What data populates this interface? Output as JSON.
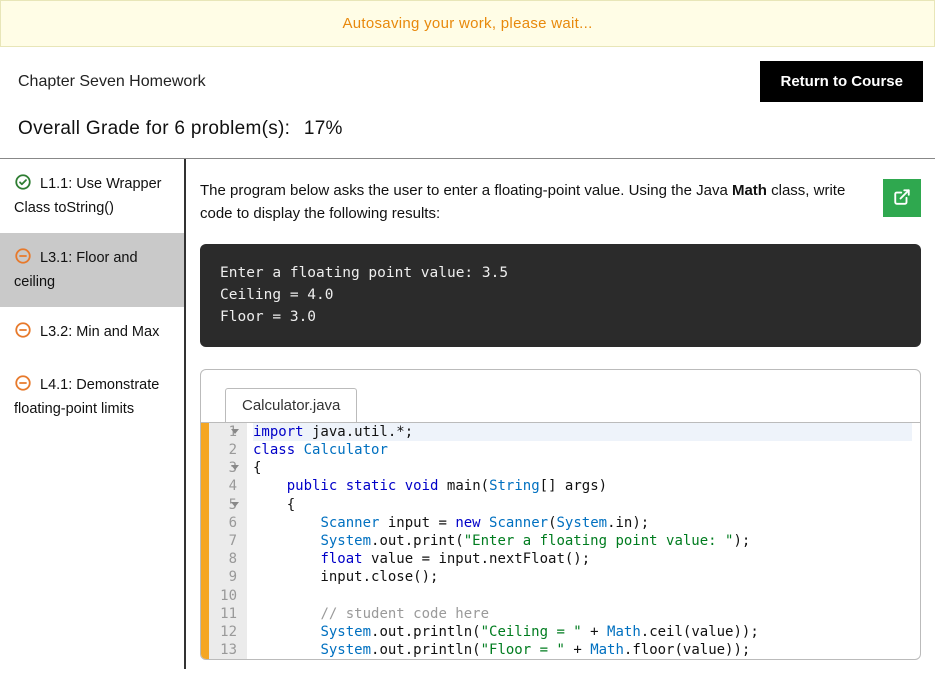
{
  "banner": {
    "text": "Autosaving your work, please wait..."
  },
  "header": {
    "chapter_title": "Chapter Seven Homework",
    "return_label": "Return to Course"
  },
  "grade": {
    "prefix": "Overall Grade for 6 problem(s):",
    "percent": "17%"
  },
  "sidebar": {
    "items": [
      {
        "id": "l1-1",
        "label": "L1.1: Use Wrapper Class toString()",
        "status": "complete",
        "selected": false
      },
      {
        "id": "l3-1",
        "label": "L3.1: Floor and ceiling",
        "status": "pending",
        "selected": true
      },
      {
        "id": "l3-2",
        "label": "L3.2: Min and Max",
        "status": "pending",
        "selected": false
      },
      {
        "id": "l4-1",
        "label": "L4.1: Demonstrate floating-point limits",
        "status": "pending",
        "selected": false
      }
    ]
  },
  "problem": {
    "instructions_pre": "The program below asks the user to enter a floating-point value. Using the Java ",
    "instructions_bold": "Math",
    "instructions_post": " class, write code to display the following results:",
    "console_output": "Enter a floating point value: 3.5\nCeiling = 4.0\nFloor = 3.0",
    "editor": {
      "filename": "Calculator.java",
      "lines": [
        {
          "n": 1,
          "fold": true,
          "tokens": [
            [
              "kw",
              "import"
            ],
            [
              "",
              " java.util.*;"
            ]
          ]
        },
        {
          "n": 2,
          "fold": false,
          "tokens": [
            [
              "kw",
              "class"
            ],
            [
              "",
              " "
            ],
            [
              "cls",
              "Calculator"
            ]
          ]
        },
        {
          "n": 3,
          "fold": true,
          "tokens": [
            [
              "",
              "{"
            ]
          ]
        },
        {
          "n": 4,
          "fold": false,
          "tokens": [
            [
              "",
              "    "
            ],
            [
              "kw",
              "public"
            ],
            [
              "",
              " "
            ],
            [
              "kw",
              "static"
            ],
            [
              "",
              " "
            ],
            [
              "kw",
              "void"
            ],
            [
              "",
              " "
            ],
            [
              "fn",
              "main"
            ],
            [
              "",
              "("
            ],
            [
              "cls",
              "String"
            ],
            [
              "",
              "[] args)"
            ]
          ]
        },
        {
          "n": 5,
          "fold": true,
          "tokens": [
            [
              "",
              "    {"
            ]
          ]
        },
        {
          "n": 6,
          "fold": false,
          "tokens": [
            [
              "",
              "        "
            ],
            [
              "cls",
              "Scanner"
            ],
            [
              "",
              " input = "
            ],
            [
              "kw",
              "new"
            ],
            [
              "",
              " "
            ],
            [
              "cls",
              "Scanner"
            ],
            [
              "",
              "("
            ],
            [
              "cls",
              "System"
            ],
            [
              "",
              ".in);"
            ]
          ]
        },
        {
          "n": 7,
          "fold": false,
          "tokens": [
            [
              "",
              "        "
            ],
            [
              "cls",
              "System"
            ],
            [
              "",
              ".out.print("
            ],
            [
              "str",
              "\"Enter a floating point value: \""
            ],
            [
              "",
              ");"
            ]
          ]
        },
        {
          "n": 8,
          "fold": false,
          "tokens": [
            [
              "",
              "        "
            ],
            [
              "kw",
              "float"
            ],
            [
              "",
              " value = input.nextFloat();"
            ]
          ]
        },
        {
          "n": 9,
          "fold": false,
          "tokens": [
            [
              "",
              "        input.close();"
            ]
          ]
        },
        {
          "n": 10,
          "fold": false,
          "tokens": [
            [
              "",
              ""
            ]
          ]
        },
        {
          "n": 11,
          "fold": false,
          "tokens": [
            [
              "",
              "        "
            ],
            [
              "cmt",
              "// student code here"
            ]
          ]
        },
        {
          "n": 12,
          "fold": false,
          "tokens": [
            [
              "",
              "        "
            ],
            [
              "cls",
              "System"
            ],
            [
              "",
              ".out.println("
            ],
            [
              "str",
              "\"Ceiling = \""
            ],
            [
              "",
              " + "
            ],
            [
              "cls",
              "Math"
            ],
            [
              "",
              ".ceil(value));"
            ]
          ]
        },
        {
          "n": 13,
          "fold": false,
          "tokens": [
            [
              "",
              "        "
            ],
            [
              "cls",
              "System"
            ],
            [
              "",
              ".out.println("
            ],
            [
              "str",
              "\"Floor = \""
            ],
            [
              "",
              " + "
            ],
            [
              "cls",
              "Math"
            ],
            [
              "",
              ".floor(value));"
            ]
          ]
        }
      ]
    }
  },
  "icons": {
    "check_color": "#2e7d32",
    "pending_color": "#e7792b",
    "popout_bg": "#2fa84f"
  }
}
